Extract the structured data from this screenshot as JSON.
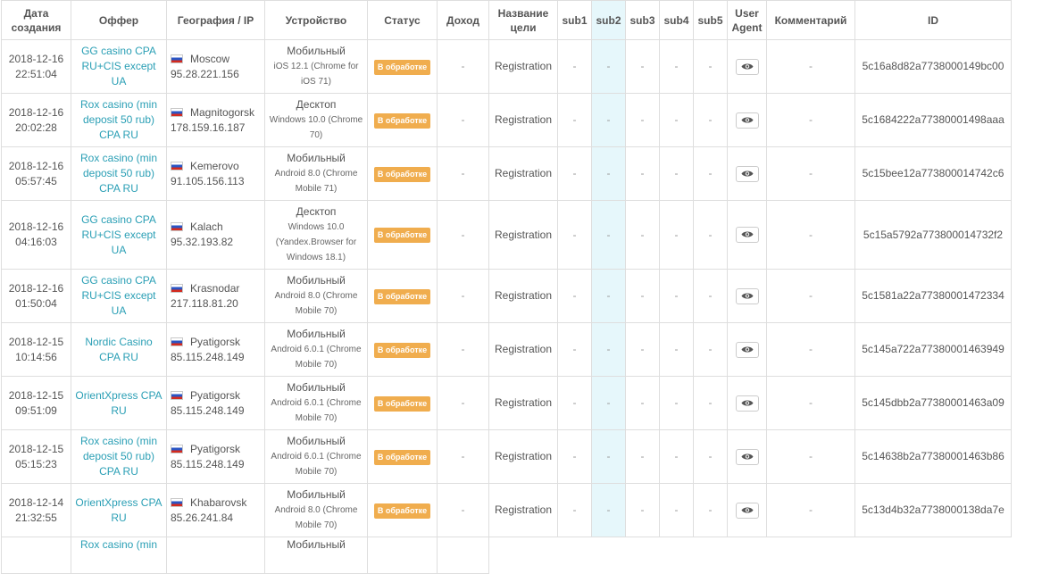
{
  "headers": {
    "date": "Дата создания",
    "offer": "Оффер",
    "geo": "География / IP",
    "device": "Устройство",
    "status": "Статус",
    "income": "Доход",
    "goal": "Название цели",
    "sub1": "sub1",
    "sub2": "sub2",
    "sub3": "sub3",
    "sub4": "sub4",
    "sub5": "sub5",
    "ua": "User Agent",
    "comment": "Комментарий",
    "id": "ID"
  },
  "rows": [
    {
      "date": "2018-12-16",
      "time": "22:51:04",
      "offer": "GG casino CPA RU+CIS except UA",
      "city": "Moscow",
      "ip": "95.28.221.156",
      "dev_type": "Мобильный",
      "dev_os": "iOS 12.1 (Chrome for iOS 71)",
      "status": "В обработке",
      "income": "-",
      "goal": "Registration",
      "sub1": "-",
      "sub2": "-",
      "sub3": "-",
      "sub4": "-",
      "sub5": "-",
      "comment": "-",
      "id": "5c16a8d82a7738000149bc00"
    },
    {
      "date": "2018-12-16",
      "time": "20:02:28",
      "offer": "Rox casino (min deposit 50 rub) CPA RU",
      "city": "Magnitogorsk",
      "ip": "178.159.16.187",
      "dev_type": "Десктоп",
      "dev_os": "Windows 10.0 (Chrome 70)",
      "status": "В обработке",
      "income": "-",
      "goal": "Registration",
      "sub1": "-",
      "sub2": "-",
      "sub3": "-",
      "sub4": "-",
      "sub5": "-",
      "comment": "-",
      "id": "5c1684222a77380001498aaa"
    },
    {
      "date": "2018-12-16",
      "time": "05:57:45",
      "offer": "Rox casino (min deposit 50 rub) CPA RU",
      "city": "Kemerovo",
      "ip": "91.105.156.113",
      "dev_type": "Мобильный",
      "dev_os": "Android 8.0 (Chrome Mobile 71)",
      "status": "В обработке",
      "income": "-",
      "goal": "Registration",
      "sub1": "-",
      "sub2": "-",
      "sub3": "-",
      "sub4": "-",
      "sub5": "-",
      "comment": "-",
      "id": "5c15bee12a773800014742c6"
    },
    {
      "date": "2018-12-16",
      "time": "04:16:03",
      "offer": "GG casino CPA RU+CIS except UA",
      "city": "Kalach",
      "ip": "95.32.193.82",
      "dev_type": "Десктоп",
      "dev_os": "Windows 10.0 (Yandex.Browser for Windows 18.1)",
      "status": "В обработке",
      "income": "-",
      "goal": "Registration",
      "sub1": "-",
      "sub2": "-",
      "sub3": "-",
      "sub4": "-",
      "sub5": "-",
      "comment": "-",
      "id": "5c15a5792a773800014732f2"
    },
    {
      "date": "2018-12-16",
      "time": "01:50:04",
      "offer": "GG casino CPA RU+CIS except UA",
      "city": "Krasnodar",
      "ip": "217.118.81.20",
      "dev_type": "Мобильный",
      "dev_os": "Android 8.0 (Chrome Mobile 70)",
      "status": "В обработке",
      "income": "-",
      "goal": "Registration",
      "sub1": "-",
      "sub2": "-",
      "sub3": "-",
      "sub4": "-",
      "sub5": "-",
      "comment": "-",
      "id": "5c1581a22a77380001472334"
    },
    {
      "date": "2018-12-15",
      "time": "10:14:56",
      "offer": "Nordic Casino CPA RU",
      "city": "Pyatigorsk",
      "ip": "85.115.248.149",
      "dev_type": "Мобильный",
      "dev_os": "Android 6.0.1 (Chrome Mobile 70)",
      "status": "В обработке",
      "income": "-",
      "goal": "Registration",
      "sub1": "-",
      "sub2": "-",
      "sub3": "-",
      "sub4": "-",
      "sub5": "-",
      "comment": "-",
      "id": "5c145a722a77380001463949"
    },
    {
      "date": "2018-12-15",
      "time": "09:51:09",
      "offer": "OrientXpress CPA RU",
      "city": "Pyatigorsk",
      "ip": "85.115.248.149",
      "dev_type": "Мобильный",
      "dev_os": "Android 6.0.1 (Chrome Mobile 70)",
      "status": "В обработке",
      "income": "-",
      "goal": "Registration",
      "sub1": "-",
      "sub2": "-",
      "sub3": "-",
      "sub4": "-",
      "sub5": "-",
      "comment": "-",
      "id": "5c145dbb2a77380001463a09"
    },
    {
      "date": "2018-12-15",
      "time": "05:15:23",
      "offer": "Rox casino (min deposit 50 rub) CPA RU",
      "city": "Pyatigorsk",
      "ip": "85.115.248.149",
      "dev_type": "Мобильный",
      "dev_os": "Android 6.0.1 (Chrome Mobile 70)",
      "status": "В обработке",
      "income": "-",
      "goal": "Registration",
      "sub1": "-",
      "sub2": "-",
      "sub3": "-",
      "sub4": "-",
      "sub5": "-",
      "comment": "-",
      "id": "5c14638b2a77380001463b86"
    },
    {
      "date": "2018-12-14",
      "time": "21:32:55",
      "offer": "OrientXpress CPA RU",
      "city": "Khabarovsk",
      "ip": "85.26.241.84",
      "dev_type": "Мобильный",
      "dev_os": "Android 8.0 (Chrome Mobile 70)",
      "status": "В обработке",
      "income": "-",
      "goal": "Registration",
      "sub1": "-",
      "sub2": "-",
      "sub3": "-",
      "sub4": "-",
      "sub5": "-",
      "comment": "-",
      "id": "5c13d4b32a7738000138da7e"
    },
    {
      "offer": "Rox casino (min",
      "dev_type": "Мобильный"
    }
  ],
  "icons": {
    "ua_button": "eye-icon",
    "flag": "russia-flag-icon"
  },
  "colors": {
    "offer_link": "#2a9fb5",
    "status_badge": "#f0ad4e",
    "sub2_column": "#e6f7fb",
    "border": "#dedede"
  }
}
